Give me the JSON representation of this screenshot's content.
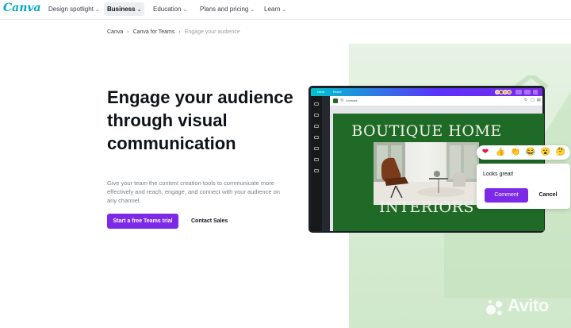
{
  "nav": {
    "logo": "Canva",
    "items": [
      {
        "label": "Design spotlight",
        "chevron": "⌄"
      },
      {
        "label": "Business",
        "chevron": "⌄"
      },
      {
        "label": "Education",
        "chevron": "⌄"
      },
      {
        "label": "Plans and pricing",
        "chevron": "⌄"
      },
      {
        "label": "Learn",
        "chevron": "⌄"
      }
    ],
    "active": "Business"
  },
  "breadcrumb": {
    "items": [
      "Canva",
      "Canva for Teams",
      "Engage your audience"
    ],
    "separator": "›"
  },
  "hero": {
    "title": "Engage your audience through visual communication",
    "description": "Give your team the content creation tools to communicate more effectively and reach, engage, and connect with your audience on any channel.",
    "primary_cta": "Start a free Teams trial",
    "secondary_cta": "Contact Sales"
  },
  "editor": {
    "topbar": {
      "home": "Home",
      "file": "Resize"
    },
    "toolbar_text": "Animate",
    "design_title": "BOUTIQUE HOME",
    "design_subtitle": "INTERIORS"
  },
  "comment": {
    "reactions": [
      "❤",
      "👍",
      "👏",
      "😂",
      "😮",
      "🤔"
    ],
    "text": "Looks great!",
    "submit": "Comment",
    "cancel": "Cancel"
  },
  "watermark": "Avito",
  "colors": {
    "brand_purple": "#7d2ae8",
    "logo_teal": "#00a9c9",
    "design_green": "#1f6a27",
    "decor_green": "#d7ecd3"
  }
}
